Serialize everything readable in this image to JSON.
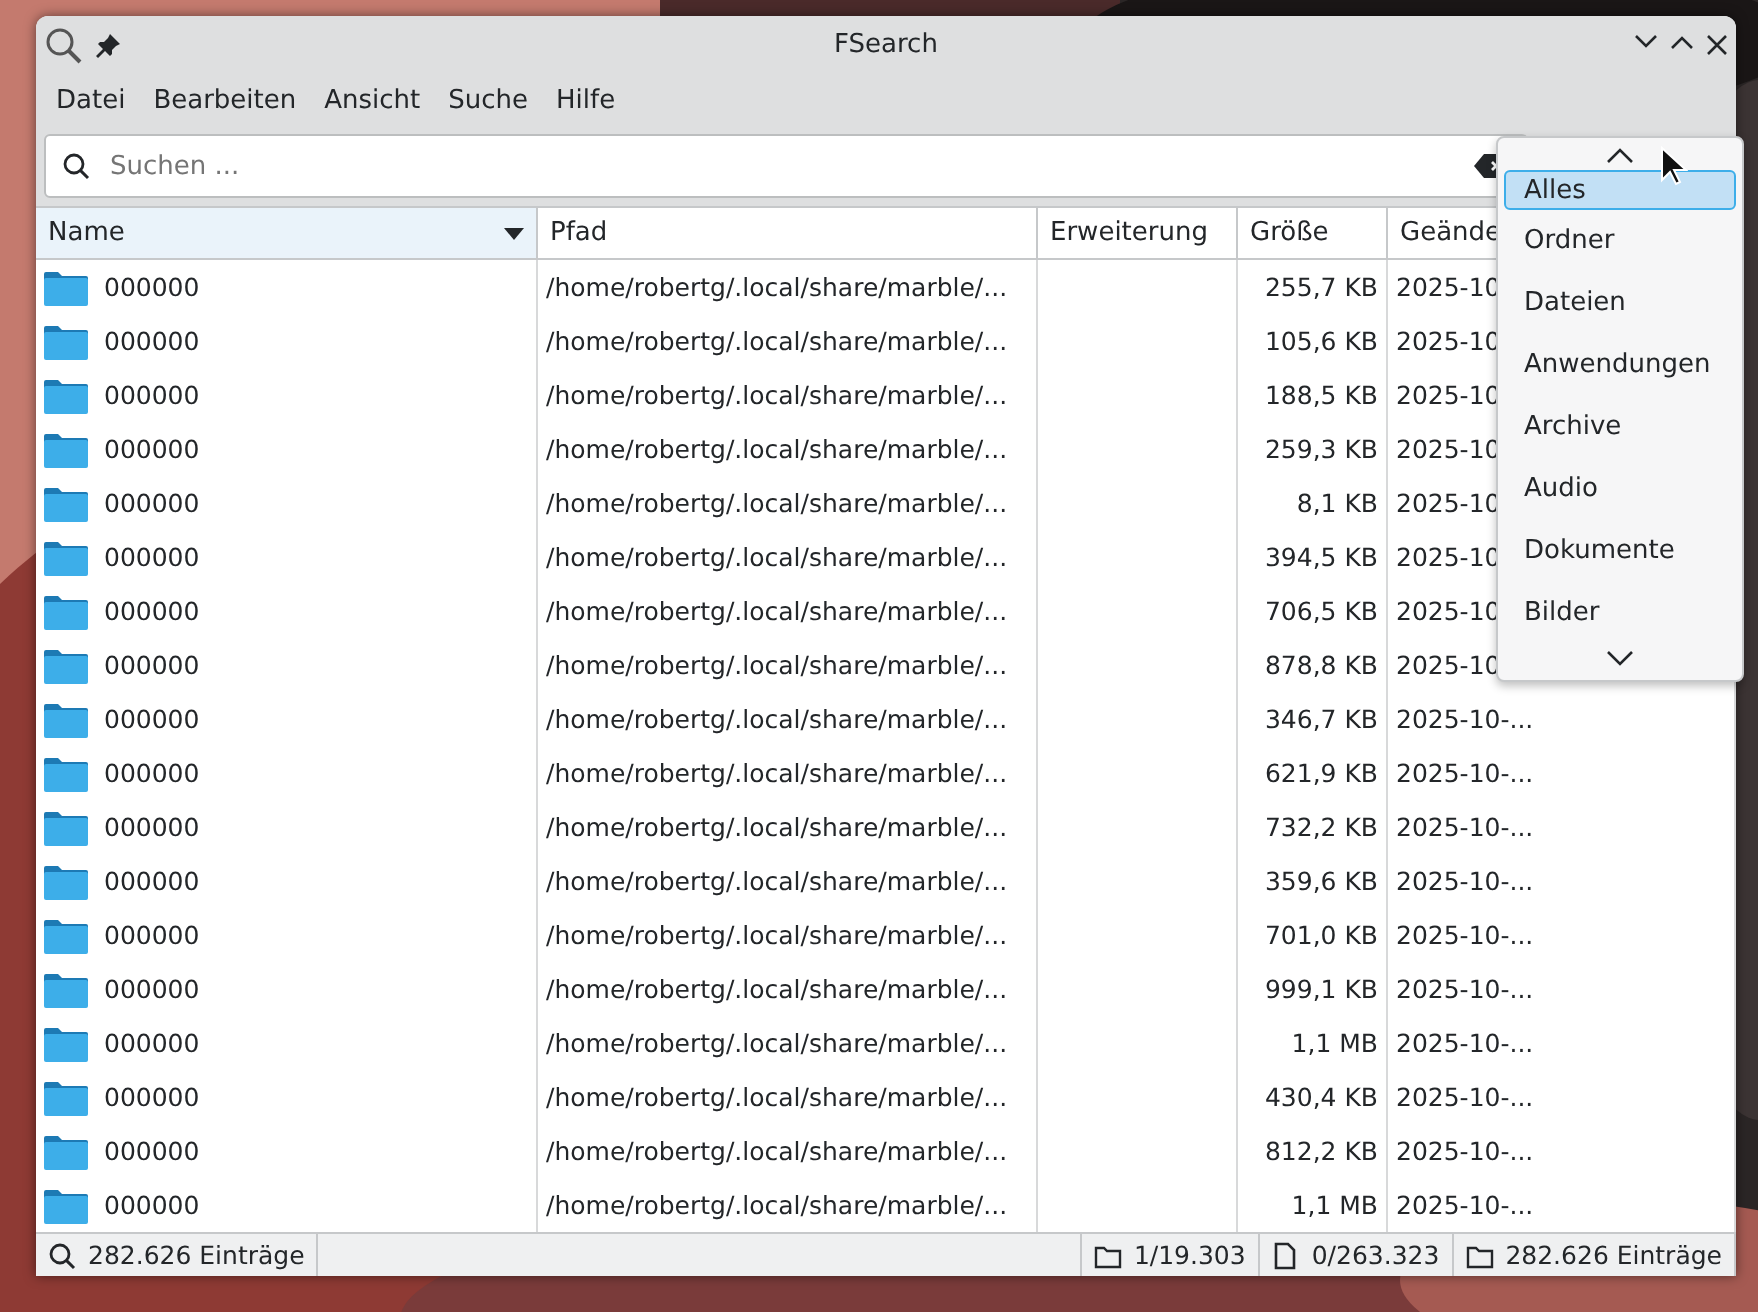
{
  "window": {
    "title": "FSearch"
  },
  "menu": [
    "Datei",
    "Bearbeiten",
    "Ansicht",
    "Suche",
    "Hilfe"
  ],
  "search": {
    "placeholder": "Suchen ..."
  },
  "filter_popup": {
    "items": [
      {
        "label": "Alles",
        "selected": true
      },
      {
        "label": "Ordner",
        "selected": false
      },
      {
        "label": "Dateien",
        "selected": false
      },
      {
        "label": "Anwendungen",
        "selected": false
      },
      {
        "label": "Archive",
        "selected": false
      },
      {
        "label": "Audio",
        "selected": false
      },
      {
        "label": "Dokumente",
        "selected": false
      },
      {
        "label": "Bilder",
        "selected": false
      }
    ]
  },
  "table": {
    "columns": [
      {
        "label": "Name",
        "sorted": true
      },
      {
        "label": "Pfad",
        "sorted": false
      },
      {
        "label": "Erweiterung",
        "sorted": false
      },
      {
        "label": "Größe",
        "sorted": false
      },
      {
        "label": "Geände",
        "sorted": false
      }
    ],
    "rows": [
      [
        "000000",
        "/home/robertg/.local/share/marble/...",
        "",
        "255,7 KB",
        "2025-10"
      ],
      [
        "000000",
        "/home/robertg/.local/share/marble/...",
        "",
        "105,6 KB",
        "2025-10"
      ],
      [
        "000000",
        "/home/robertg/.local/share/marble/...",
        "",
        "188,5 KB",
        "2025-10"
      ],
      [
        "000000",
        "/home/robertg/.local/share/marble/...",
        "",
        "259,3 KB",
        "2025-10"
      ],
      [
        "000000",
        "/home/robertg/.local/share/marble/...",
        "",
        "8,1 KB",
        "2025-10"
      ],
      [
        "000000",
        "/home/robertg/.local/share/marble/...",
        "",
        "394,5 KB",
        "2025-10"
      ],
      [
        "000000",
        "/home/robertg/.local/share/marble/...",
        "",
        "706,5 KB",
        "2025-10"
      ],
      [
        "000000",
        "/home/robertg/.local/share/marble/...",
        "",
        "878,8 KB",
        "2025-10"
      ],
      [
        "000000",
        "/home/robertg/.local/share/marble/...",
        "",
        "346,7 KB",
        "2025-10-..."
      ],
      [
        "000000",
        "/home/robertg/.local/share/marble/...",
        "",
        "621,9 KB",
        "2025-10-..."
      ],
      [
        "000000",
        "/home/robertg/.local/share/marble/...",
        "",
        "732,2 KB",
        "2025-10-..."
      ],
      [
        "000000",
        "/home/robertg/.local/share/marble/...",
        "",
        "359,6 KB",
        "2025-10-..."
      ],
      [
        "000000",
        "/home/robertg/.local/share/marble/...",
        "",
        "701,0 KB",
        "2025-10-..."
      ],
      [
        "000000",
        "/home/robertg/.local/share/marble/...",
        "",
        "999,1 KB",
        "2025-10-..."
      ],
      [
        "000000",
        "/home/robertg/.local/share/marble/...",
        "",
        "1,1 MB",
        "2025-10-..."
      ],
      [
        "000000",
        "/home/robertg/.local/share/marble/...",
        "",
        "430,4 KB",
        "2025-10-..."
      ],
      [
        "000000",
        "/home/robertg/.local/share/marble/...",
        "",
        "812,2 KB",
        "2025-10-..."
      ],
      [
        "000000",
        "/home/robertg/.local/share/marble/...",
        "",
        "1,1 MB",
        "2025-10-..."
      ]
    ]
  },
  "status_bar": [
    {
      "kind": "search",
      "text": "282.626 Einträge"
    },
    {
      "kind": "empty"
    },
    {
      "kind": "folder",
      "text": "1/19.303"
    },
    {
      "kind": "file",
      "text": "0/263.323"
    },
    {
      "kind": "folder",
      "text": "282.626 Einträge"
    }
  ]
}
